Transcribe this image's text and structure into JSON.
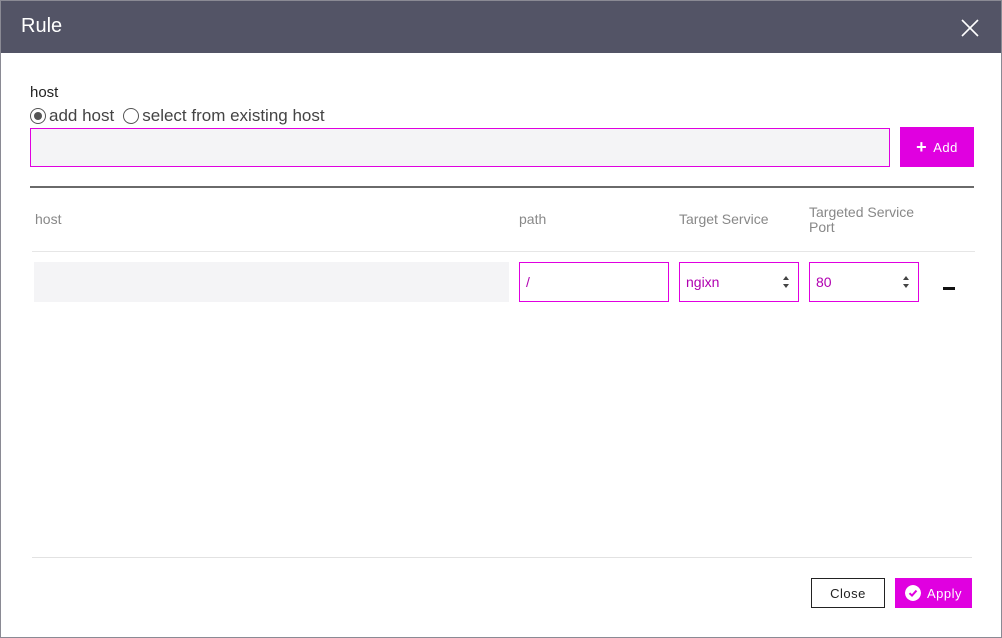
{
  "dialog": {
    "title": "Rule"
  },
  "host_section": {
    "label": "host",
    "radio_options": [
      {
        "label": "add host",
        "checked": true
      },
      {
        "label": "select from existing host",
        "checked": false
      }
    ],
    "input_value": "",
    "add_button_label": "Add"
  },
  "table": {
    "columns": [
      "host",
      "path",
      "Target Service",
      "Targeted Service Port"
    ],
    "rows": [
      {
        "host": "",
        "path": "/",
        "target_service": "ngixn",
        "port": "80"
      }
    ]
  },
  "footer": {
    "close_label": "Close",
    "apply_label": "Apply"
  },
  "colors": {
    "accent": "#e000e0",
    "titlebar": "#535466"
  },
  "icons": [
    "close-icon",
    "plus-icon",
    "select-arrows-icon",
    "minus-icon",
    "check-circle-icon"
  ]
}
